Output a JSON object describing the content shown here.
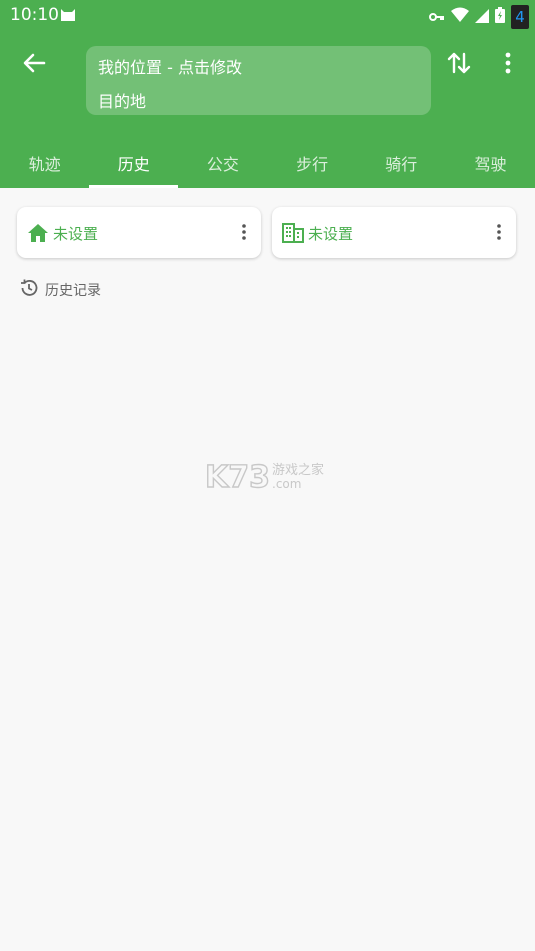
{
  "status_bar": {
    "time": "10:10",
    "badge": "4"
  },
  "search": {
    "origin": "我的位置 - 点击修改",
    "destination": "目的地"
  },
  "tabs": [
    {
      "label": "轨迹"
    },
    {
      "label": "历史"
    },
    {
      "label": "公交"
    },
    {
      "label": "步行"
    },
    {
      "label": "骑行"
    },
    {
      "label": "驾驶"
    }
  ],
  "shortcuts": {
    "home": {
      "label": "未设置"
    },
    "company": {
      "label": "未设置"
    }
  },
  "history": {
    "label": "历史记录"
  },
  "watermark": {
    "brand": "K73",
    "site": "游戏之家",
    "domain": ".com"
  },
  "colors": {
    "primary": "#4caf50",
    "background": "#f8f8f8"
  }
}
